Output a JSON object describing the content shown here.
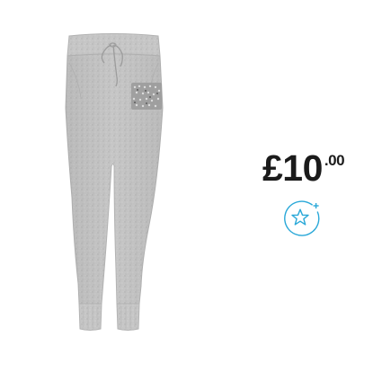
{
  "product": {
    "image_name": "grey-jogger-pants",
    "graphic_text": "GIRL MIND"
  },
  "price": {
    "main": "£10",
    "decimal": ".00"
  },
  "wishlist": {
    "icon": "star-plus-icon",
    "accent_color": "#29a8d8"
  }
}
